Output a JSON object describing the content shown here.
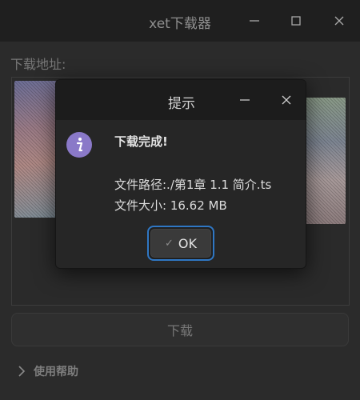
{
  "window": {
    "title": "xet下载器"
  },
  "main": {
    "address_label": "下载地址:",
    "download_button": "下载",
    "help_label": "使用帮助"
  },
  "dialog": {
    "title": "提示",
    "heading": "下载完成!",
    "path_line": "文件路径:./第1章 1.1 简介.ts",
    "size_line": "文件大小: 16.62 MB",
    "ok_label": "OK"
  },
  "colors": {
    "accent": "#2f77c4",
    "info_icon": "#8a79c8"
  },
  "icons": [
    "minimize-icon",
    "maximize-icon",
    "close-icon",
    "chevron-right-icon",
    "info-icon",
    "check-icon"
  ]
}
